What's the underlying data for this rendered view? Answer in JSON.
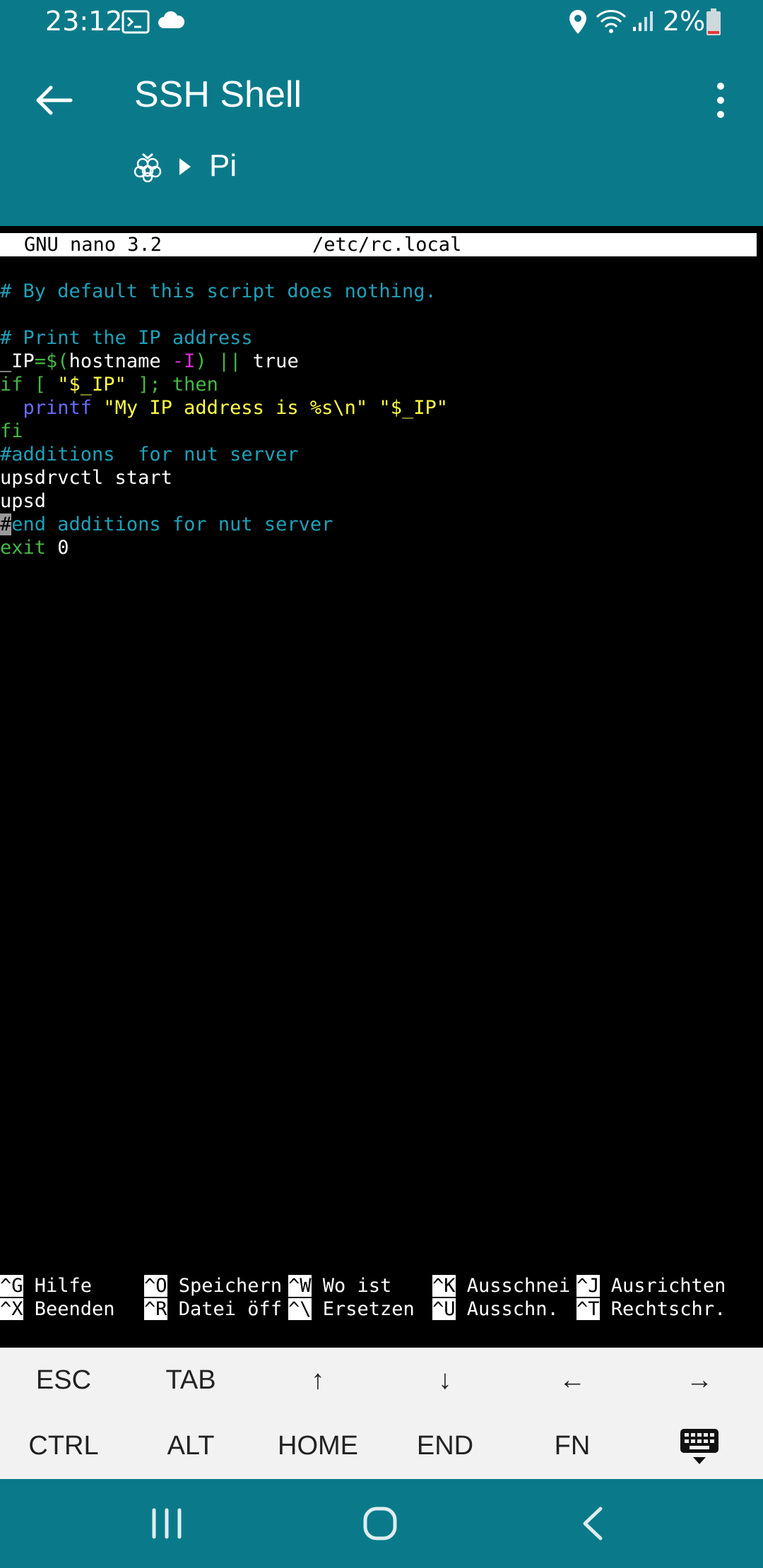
{
  "status_bar": {
    "time": "23:12",
    "battery": "2%",
    "icons": [
      "terminal-icon",
      "cloud-icon",
      "location-icon",
      "wifi-icon",
      "signal-icon",
      "battery-icon"
    ]
  },
  "app_bar": {
    "title": "SSH Shell",
    "breadcrumb_host": "Pi",
    "icons": [
      "arrow-back-icon",
      "more-vert-icon",
      "raspberry-icon",
      "chevron-right-icon"
    ]
  },
  "editor": {
    "name": "GNU nano 3.2",
    "file": "/etc/rc.local",
    "lines": [
      [],
      [
        {
          "t": "# By default this script does nothing.",
          "c": "c-cmt"
        }
      ],
      [],
      [
        {
          "t": "# Print the IP address",
          "c": "c-cmt"
        }
      ],
      [
        {
          "t": "_IP",
          "c": "c-wht"
        },
        {
          "t": "=$(",
          "c": "c-grn"
        },
        {
          "t": "hostname ",
          "c": "c-wht"
        },
        {
          "t": "-I",
          "c": "c-mag"
        },
        {
          "t": ") || ",
          "c": "c-grn"
        },
        {
          "t": "true",
          "c": "c-wht"
        }
      ],
      [
        {
          "t": "if [ ",
          "c": "c-grn"
        },
        {
          "t": "\"$_IP\"",
          "c": "c-yel"
        },
        {
          "t": " ]; then",
          "c": "c-grn"
        }
      ],
      [
        {
          "t": "  ",
          "c": "c-wht"
        },
        {
          "t": "printf",
          "c": "c-blu"
        },
        {
          "t": " \"My IP address is %s\\n\" \"$_IP\"",
          "c": "c-yel"
        }
      ],
      [
        {
          "t": "fi",
          "c": "c-grn"
        }
      ],
      [
        {
          "t": "#additions  for nut server",
          "c": "c-cmt"
        }
      ],
      [
        {
          "t": "upsdrvctl start",
          "c": "c-wht"
        }
      ],
      [
        {
          "t": "upsd",
          "c": "c-wht"
        }
      ],
      [
        {
          "t": "#",
          "c": "cursor"
        },
        {
          "t": "end additions for nut server",
          "c": "c-cmt"
        }
      ],
      [
        {
          "t": "exit",
          "c": "c-grn"
        },
        {
          "t": " 0",
          "c": "c-wht"
        }
      ]
    ],
    "shortcuts_row1": [
      {
        "key": "^G",
        "label": " Hilfe"
      },
      {
        "key": "^O",
        "label": " Speichern"
      },
      {
        "key": "^W",
        "label": " Wo ist"
      },
      {
        "key": "^K",
        "label": " Ausschnei"
      },
      {
        "key": "^J",
        "label": " Ausrichten"
      }
    ],
    "shortcuts_row2": [
      {
        "key": "^X",
        "label": " Beenden"
      },
      {
        "key": "^R",
        "label": " Datei öff"
      },
      {
        "key": "^\\",
        "label": " Ersetzen"
      },
      {
        "key": "^U",
        "label": " Ausschn."
      },
      {
        "key": "^T",
        "label": " Rechtschr."
      }
    ]
  },
  "extra_keys": {
    "row1": [
      "ESC",
      "TAB",
      "↑",
      "↓",
      "←",
      "→"
    ],
    "row2": [
      "CTRL",
      "ALT",
      "HOME",
      "END",
      "FN"
    ],
    "keyboard_toggle_icon": "keyboard-icon"
  },
  "nav_bar": {
    "icons": [
      "recents-icon",
      "home-icon",
      "back-icon"
    ]
  },
  "colors": {
    "brand": "#0a7a8a",
    "comment": "#1fa0b8",
    "keyword": "#45b845",
    "string": "#ffff44"
  }
}
